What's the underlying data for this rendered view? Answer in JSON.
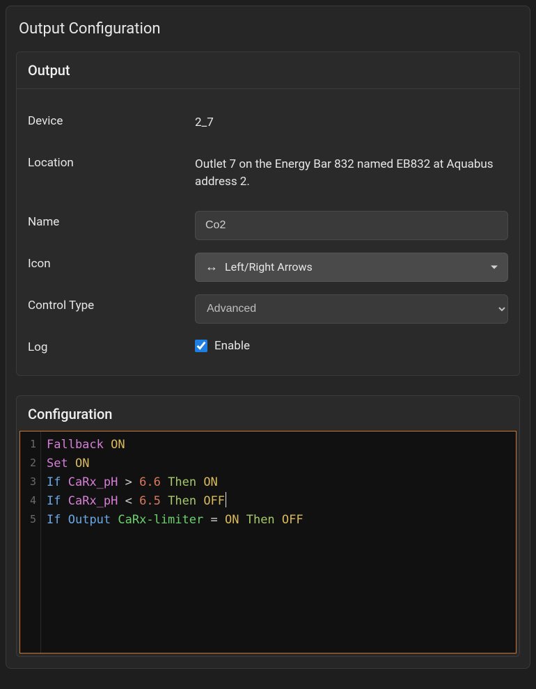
{
  "page": {
    "title": "Output Configuration"
  },
  "output_card": {
    "header": "Output",
    "device_label": "Device",
    "device_value": "2_7",
    "location_label": "Location",
    "location_value": "Outlet 7 on the Energy Bar 832 named EB832 at Aquabus address 2.",
    "name_label": "Name",
    "name_value": "Co2",
    "icon_label": "Icon",
    "icon_select": {
      "glyph": "↔",
      "label": "Left/Right Arrows"
    },
    "control_type_label": "Control Type",
    "control_type_value": "Advanced",
    "log_label": "Log",
    "log_checkbox_label": "Enable",
    "log_checked": true
  },
  "config_card": {
    "header": "Configuration",
    "lines": [
      {
        "n": "1",
        "tokens": [
          {
            "t": "Fallback",
            "c": "tok-ident"
          },
          {
            "t": " "
          },
          {
            "t": "ON",
            "c": "tok-on"
          }
        ]
      },
      {
        "n": "2",
        "tokens": [
          {
            "t": "Set",
            "c": "tok-ident"
          },
          {
            "t": " "
          },
          {
            "t": "ON",
            "c": "tok-on"
          }
        ]
      },
      {
        "n": "3",
        "tokens": [
          {
            "t": "If",
            "c": "tok-kw"
          },
          {
            "t": " "
          },
          {
            "t": "CaRx_pH",
            "c": "tok-ident"
          },
          {
            "t": " "
          },
          {
            "t": ">",
            "c": "tok-op"
          },
          {
            "t": " "
          },
          {
            "t": "6.6",
            "c": "tok-num"
          },
          {
            "t": " "
          },
          {
            "t": "Then",
            "c": "tok-then"
          },
          {
            "t": " "
          },
          {
            "t": "ON",
            "c": "tok-on"
          }
        ]
      },
      {
        "n": "4",
        "cursor_after": true,
        "tokens": [
          {
            "t": "If",
            "c": "tok-kw"
          },
          {
            "t": " "
          },
          {
            "t": "CaRx_pH",
            "c": "tok-ident"
          },
          {
            "t": " "
          },
          {
            "t": "<",
            "c": "tok-op"
          },
          {
            "t": " "
          },
          {
            "t": "6.5",
            "c": "tok-num"
          },
          {
            "t": " "
          },
          {
            "t": "Then",
            "c": "tok-then"
          },
          {
            "t": " "
          },
          {
            "t": "OFF",
            "c": "tok-off"
          }
        ]
      },
      {
        "n": "5",
        "tokens": [
          {
            "t": "If",
            "c": "tok-kw"
          },
          {
            "t": " "
          },
          {
            "t": "Output",
            "c": "tok-output"
          },
          {
            "t": " "
          },
          {
            "t": "CaRx-limiter",
            "c": "tok-limiter"
          },
          {
            "t": " "
          },
          {
            "t": "=",
            "c": "tok-op"
          },
          {
            "t": " "
          },
          {
            "t": "ON",
            "c": "tok-on"
          },
          {
            "t": " "
          },
          {
            "t": "Then",
            "c": "tok-then"
          },
          {
            "t": " "
          },
          {
            "t": "OFF",
            "c": "tok-off"
          }
        ]
      }
    ]
  }
}
